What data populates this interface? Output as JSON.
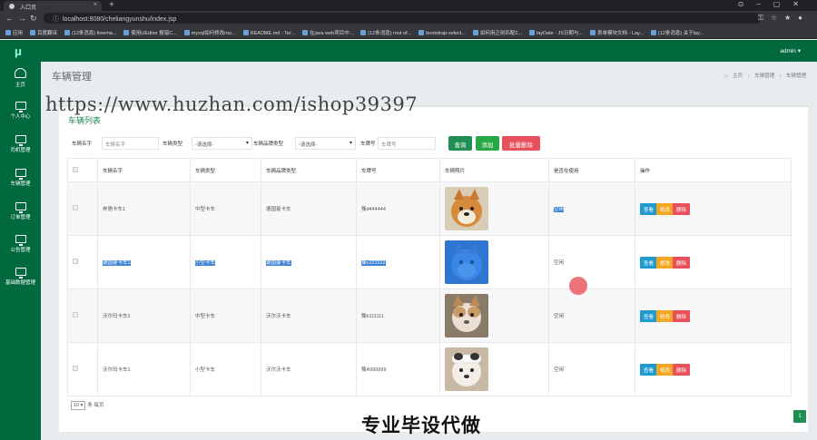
{
  "browser": {
    "tab_title": "入口页",
    "url": "localhost:8080/cheliangyunshu/index.jsp",
    "bookmarks": [
      "应用",
      "百度翻译",
      "(12条消息) freema...",
      "使用UEditor 报错C...",
      "mysql如何修改roo...",
      "README.md - Ter...",
      "在java web项目中...",
      "(12条消息) root of...",
      "bootstrap-select...",
      "如何用正则匹配2...",
      "layDate - JS日期与...",
      "表单模块文档 - Lay...",
      "(12条消息) 关于lay..."
    ]
  },
  "header": {
    "logo": "μ",
    "user": "admin ▾"
  },
  "sidebar": {
    "items": [
      {
        "label": "主页",
        "icon": "dashboard-icon"
      },
      {
        "label": "个人中心",
        "icon": "monitor-icon"
      },
      {
        "label": "司机管理",
        "icon": "monitor-icon"
      },
      {
        "label": "车辆管理",
        "icon": "monitor-icon"
      },
      {
        "label": "订单管理",
        "icon": "monitor-icon"
      },
      {
        "label": "公告管理",
        "icon": "monitor-icon"
      },
      {
        "label": "基础数据管理",
        "icon": "monitor-icon"
      }
    ]
  },
  "page": {
    "title": "车辆管理",
    "breadcrumb": [
      "主页",
      "车辆管理",
      "车辆管理"
    ],
    "card_title": "车辆列表"
  },
  "filter": {
    "name_label": "车辆名字",
    "name_placeholder": "车辆名字",
    "type_label": "车辆类型",
    "type_value": "-请选择-",
    "brand_label": "车辆品牌类型",
    "brand_value": "-请选择-",
    "plate_label": "车牌号",
    "plate_placeholder": "车牌号",
    "search_btn": "查询",
    "add_btn": "添加",
    "batch_delete_btn": "批量删除"
  },
  "table": {
    "headers": [
      "车辆名字",
      "车辆类型",
      "车辆品牌类型",
      "车牌号",
      "车辆照片",
      "是否在使用",
      "操作"
    ],
    "rows": [
      {
        "name": "奔驰卡车1",
        "type": "中型卡车",
        "brand": "德国曼卡车",
        "plate": "豫d444444",
        "status": "空闲",
        "selected": false,
        "photo": "shiba-dog-photo"
      },
      {
        "name": "德国曼卡车1",
        "type": "小型卡车",
        "brand": "德国曼卡车",
        "plate": "豫c222222",
        "status": "空闲",
        "selected": true,
        "photo": "shiba-dog-photo-selected"
      },
      {
        "name": "沃尔玛卡车2",
        "type": "中型卡车",
        "brand": "沃尔沃卡车",
        "plate": "豫b111111",
        "status": "空闲",
        "selected": false,
        "photo": "cat-dog-photo"
      },
      {
        "name": "沃尔玛卡车1",
        "type": "小型卡车",
        "brand": "沃尔沃卡车",
        "plate": "豫A999999",
        "status": "空闲",
        "selected": false,
        "photo": "bandaged-dog-photo"
      }
    ],
    "actions": {
      "view": "查看",
      "edit": "修改",
      "delete": "删除"
    }
  },
  "pager": {
    "page_size": "10",
    "per_page_suffix": "条 每页",
    "current_page": "1"
  },
  "overlay": {
    "watermark": "https://www.huzhan.com/ishop39397",
    "caption": "专业毕设代做"
  },
  "colors": {
    "primary": "#00693e",
    "search": "#1f8f55",
    "add": "#28a745",
    "danger": "#e8505b",
    "warning": "#f5a623",
    "info": "#1f9bcf"
  }
}
